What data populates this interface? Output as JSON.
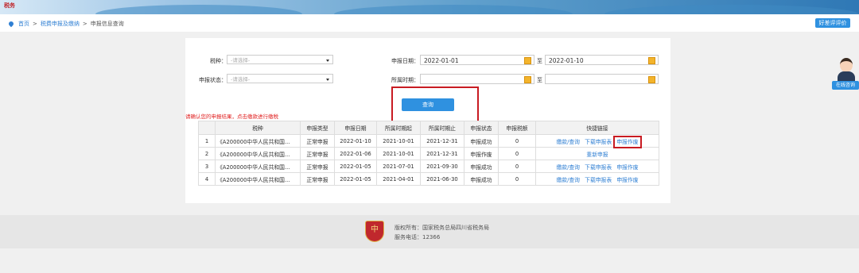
{
  "header": {
    "logo_text": "税务"
  },
  "breadcrumb": {
    "home": "首页",
    "level1": "税费申报及缴纳",
    "current": "申报信息查询",
    "sep": ">"
  },
  "review_button": "好差评评价",
  "service_tag": "在线咨询",
  "form": {
    "tax_type_label": "税种：",
    "tax_type_placeholder": "-请选择-",
    "status_label": "申报状态：",
    "status_placeholder": "-请选择-",
    "date_label": "申报日期：",
    "date_from": "2022-01-01",
    "to_label": "至",
    "date_to": "2022-01-10",
    "period_label": "所属时期：",
    "period_from": "",
    "period_to": ""
  },
  "query_button": "查询",
  "warning": "请确认您的申报结果，点击缴款进行缴税",
  "table": {
    "headers": [
      "",
      "税种",
      "申报类型",
      "申报日期",
      "所属时期起",
      "所属时期止",
      "申报状态",
      "申报税额",
      "快捷链接"
    ],
    "rows": [
      {
        "no": "1",
        "name": "《A200000中华人民共和国...",
        "type": "正常申报",
        "date": "2022-01-10",
        "start": "2021-10-01",
        "end": "2021-12-31",
        "status": "申报成功",
        "amount": "0",
        "links": [
          "缴款/查询",
          "下载申报表",
          "申报作废"
        ]
      },
      {
        "no": "2",
        "name": "《A200000中华人民共和国...",
        "type": "正常申报",
        "date": "2022-01-06",
        "start": "2021-10-01",
        "end": "2021-12-31",
        "status": "申报作废",
        "amount": "0",
        "links": [
          "重新申报"
        ]
      },
      {
        "no": "3",
        "name": "《A200000中华人民共和国...",
        "type": "正常申报",
        "date": "2022-01-05",
        "start": "2021-07-01",
        "end": "2021-09-30",
        "status": "申报成功",
        "amount": "0",
        "links": [
          "缴款/查询",
          "下载申报表",
          "申报作废"
        ]
      },
      {
        "no": "4",
        "name": "《A200000中华人民共和国...",
        "type": "正常申报",
        "date": "2022-01-05",
        "start": "2021-04-01",
        "end": "2021-06-30",
        "status": "申报成功",
        "amount": "0",
        "links": [
          "缴款/查询",
          "下载申报表",
          "申报作废"
        ]
      }
    ]
  },
  "footer": {
    "copyright": "版权所有：国家税务总局四川省税务局",
    "phone": "服务电话：12366",
    "emblem_text": "中"
  }
}
